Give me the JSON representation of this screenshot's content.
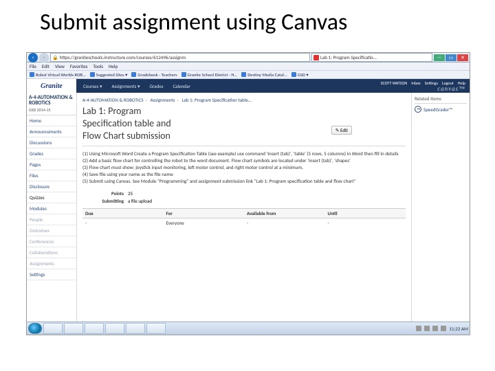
{
  "slide": {
    "title": "Submit assignment using Canvas"
  },
  "browser": {
    "url": "https://graniteschools.instructure.com/courses/612496/assignm",
    "tab_title": "Lab 1: Program Specificatio...",
    "menu": [
      "File",
      "Edit",
      "View",
      "Favorites",
      "Tools",
      "Help"
    ],
    "favorites": [
      "Robot Virtual Worlds ROB...",
      "Suggested Sites ▾",
      "Gradebook - Teachers",
      "Granite School District - H...",
      "Destiny Media Catal...",
      "GSD ▾"
    ],
    "win": {
      "min": "—",
      "max": "▭",
      "close": "✕"
    }
  },
  "canvas": {
    "logo": "Granite",
    "nav": [
      "Courses ▾",
      "Assignments ▾",
      "Grades",
      "Calendar"
    ],
    "user": "SCOTT WATSON",
    "links": [
      "Inbox",
      "Settings",
      "Logout",
      "Help"
    ],
    "brand": "canvas™"
  },
  "leftnav": {
    "course_code": "A-4-AUTOMATION & ROBOTICS",
    "course_term": "GSD 2014-15",
    "items": [
      {
        "label": "Home",
        "dim": false
      },
      {
        "label": "Announcements",
        "dim": false
      },
      {
        "label": "Discussions",
        "dim": false
      },
      {
        "label": "Grades",
        "dim": false
      },
      {
        "label": "Pages",
        "dim": false
      },
      {
        "label": "Files",
        "dim": false
      },
      {
        "label": "Disclosure",
        "dim": false
      },
      {
        "label": "Quizzes",
        "dim": false,
        "active": true
      },
      {
        "label": "Modules",
        "dim": false
      },
      {
        "label": "People",
        "dim": true
      },
      {
        "label": "Outcomes",
        "dim": true
      },
      {
        "label": "Conferences",
        "dim": true
      },
      {
        "label": "Collaborations",
        "dim": true
      },
      {
        "label": "Assignments",
        "dim": true
      },
      {
        "label": "Settings",
        "dim": false
      }
    ]
  },
  "crumbs": [
    "A-4-AUTOMATION & ROBOTICS",
    "Assignments",
    "Lab 1: Program Specification table..."
  ],
  "assignment": {
    "title_l1": "Lab 1: Program",
    "title_l2": "Specification table and",
    "title_l3": "Flow Chart submission",
    "edit": "✎ Edit",
    "instructions": [
      "(1) Using Microsoft Word Create a Program Specification Table (see example) use command 'Insert (tab)', 'table' (5 rows, 5 columns) in Word then fill in details",
      "(2) Add a basic flow chart for controlling the robot to the word document.  Flow chart symbols are located under 'Insert (tab)', 'shapes'",
      "(3) Flow chart must show: joystick input monitoring, left motor control, and right motor control at a minimum.",
      "(4) Save file using your name as the file name",
      "(5) Submit using Canvas.  See Module \"Programming\" and assignment submission link \"Lab 1: Program specification table and flow chart\""
    ],
    "points_label": "Points",
    "points_value": "25",
    "submitting_label": "Submitting",
    "submitting_value": "a file upload",
    "table_headers": [
      "Due",
      "For",
      "Available from",
      "Until"
    ],
    "table_row": [
      "-",
      "Everyone",
      "-",
      "-"
    ]
  },
  "related": {
    "heading": "Related Items",
    "item": "SpeedGrader™"
  },
  "taskbar": {
    "time": "11:22 AM"
  }
}
